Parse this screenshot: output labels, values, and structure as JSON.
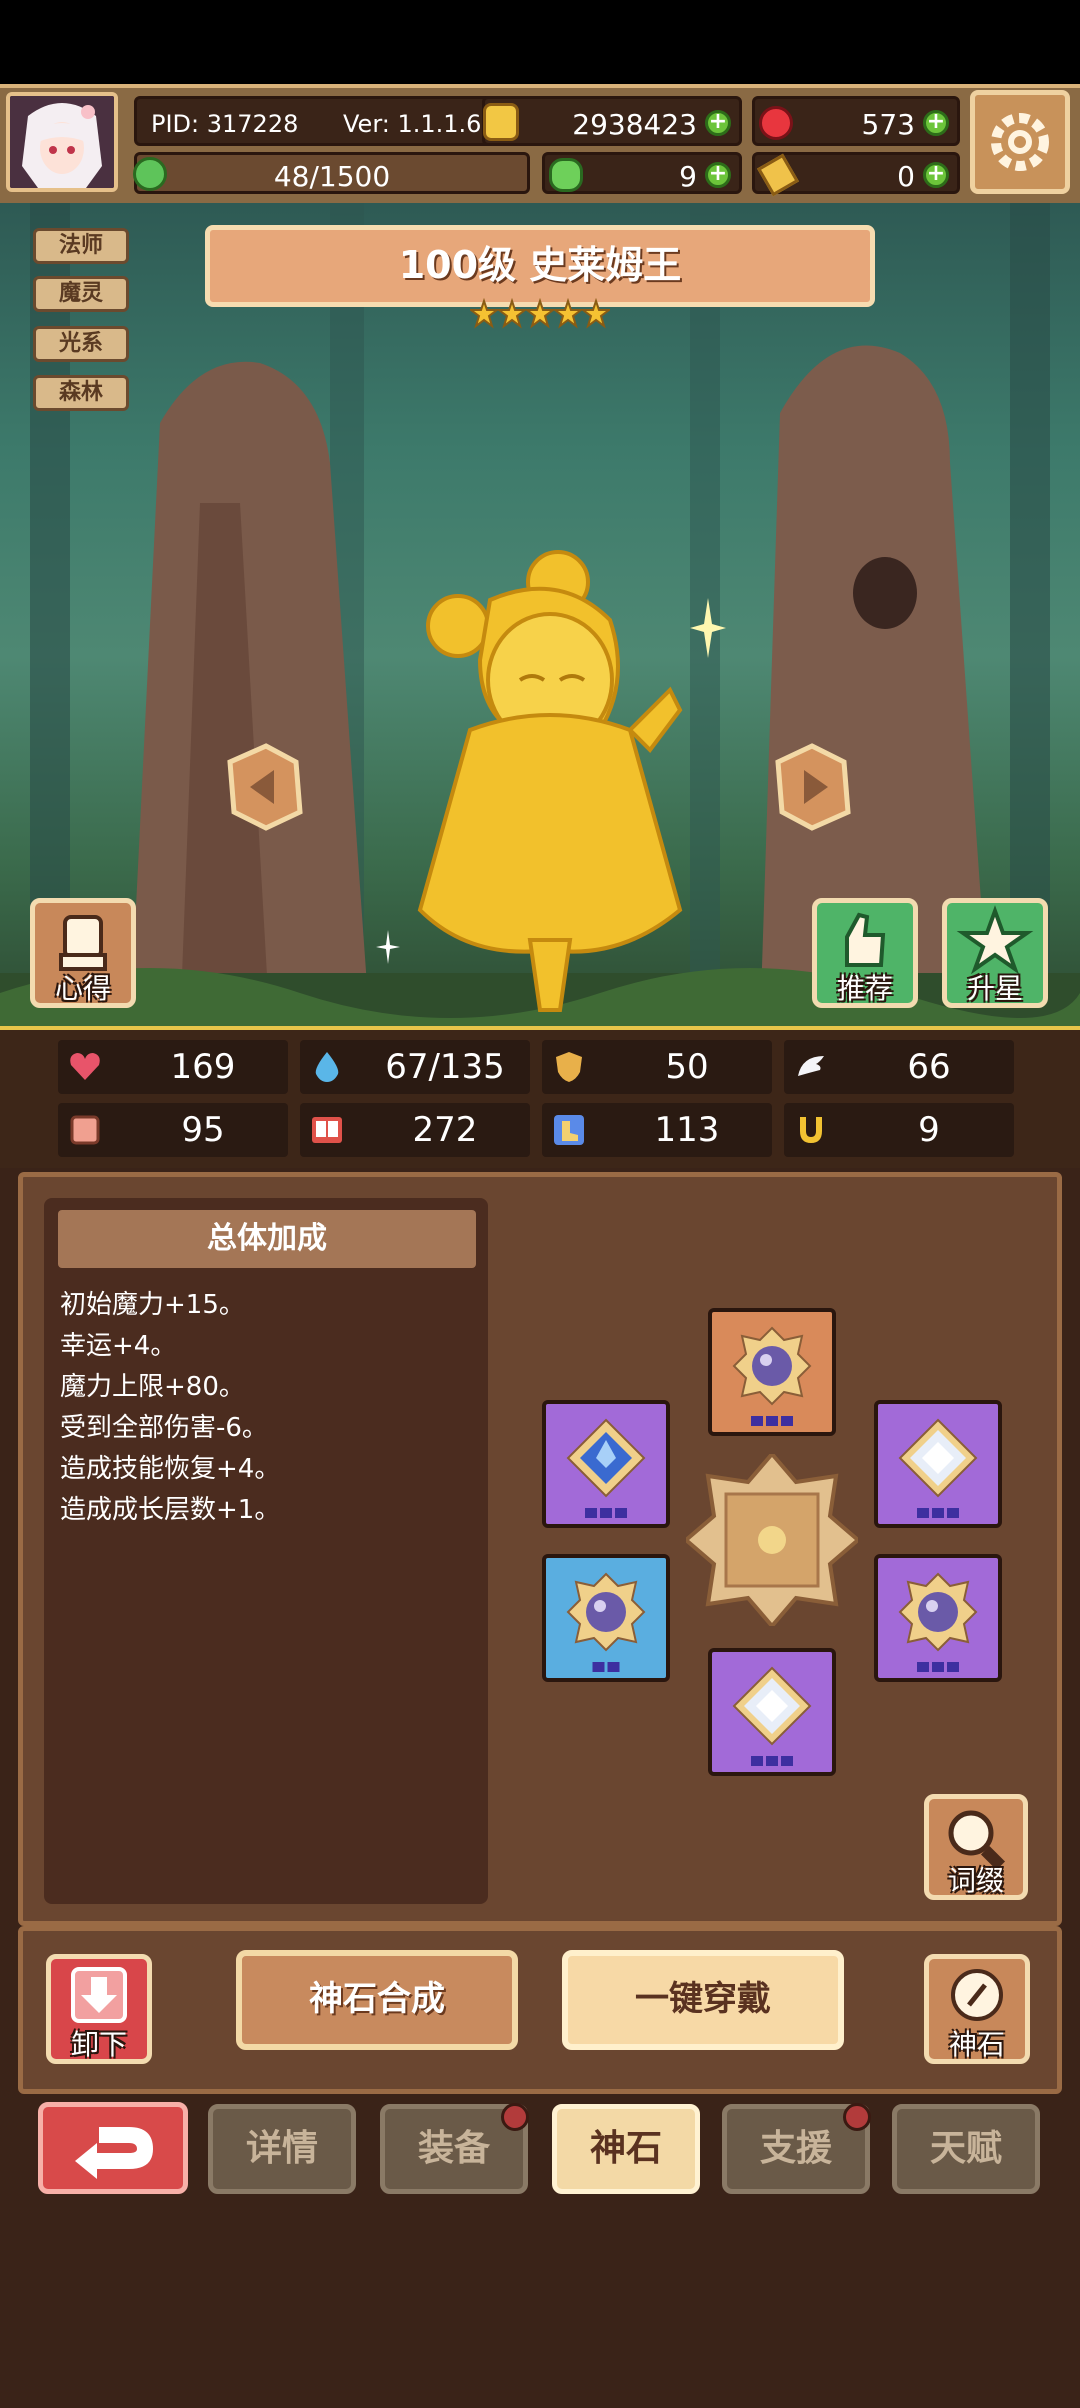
{
  "header": {
    "pid": "PID: 317228",
    "version": "Ver: 1.1.1.6",
    "gold": "2938423",
    "gems": "573",
    "energy": "48/1500",
    "clover": "9",
    "key": "0"
  },
  "tags": [
    "法师",
    "魔灵",
    "光系",
    "森林"
  ],
  "hero": {
    "title": "100级  史莱姆王",
    "stars": 5
  },
  "side_buttons": {
    "notes": "心得",
    "recommend": "推荐",
    "star_up": "升星"
  },
  "stats": [
    {
      "icon": "heart-icon",
      "value": "169"
    },
    {
      "icon": "mana-drop-icon",
      "value": "67/135"
    },
    {
      "icon": "shield-icon",
      "value": "50"
    },
    {
      "icon": "wing-icon",
      "value": "66"
    },
    {
      "icon": "fist-icon",
      "value": "95"
    },
    {
      "icon": "book-icon",
      "value": "272"
    },
    {
      "icon": "boot-icon",
      "value": "113"
    },
    {
      "icon": "horseshoe-icon",
      "value": "9"
    }
  ],
  "bonus": {
    "heading": "总体加成",
    "lines": [
      "初始魔力+15。",
      "幸运+4。",
      "魔力上限+80。",
      "受到全部伤害-6。",
      "造成技能恢复+4。",
      "造成成长层数+1。"
    ]
  },
  "actions": {
    "affix": "词缀",
    "unequip": "卸下",
    "synthesize": "神石合成",
    "equip_all": "一键穿戴",
    "godstone": "神石"
  },
  "tabs": [
    "详情",
    "装备",
    "神石",
    "支援",
    "天赋"
  ],
  "colors": {
    "accent_gold": "#e8b04a",
    "plus_green": "#6cc43a",
    "back_red": "#d84a4a",
    "tab_active": "#f3d9a6"
  }
}
